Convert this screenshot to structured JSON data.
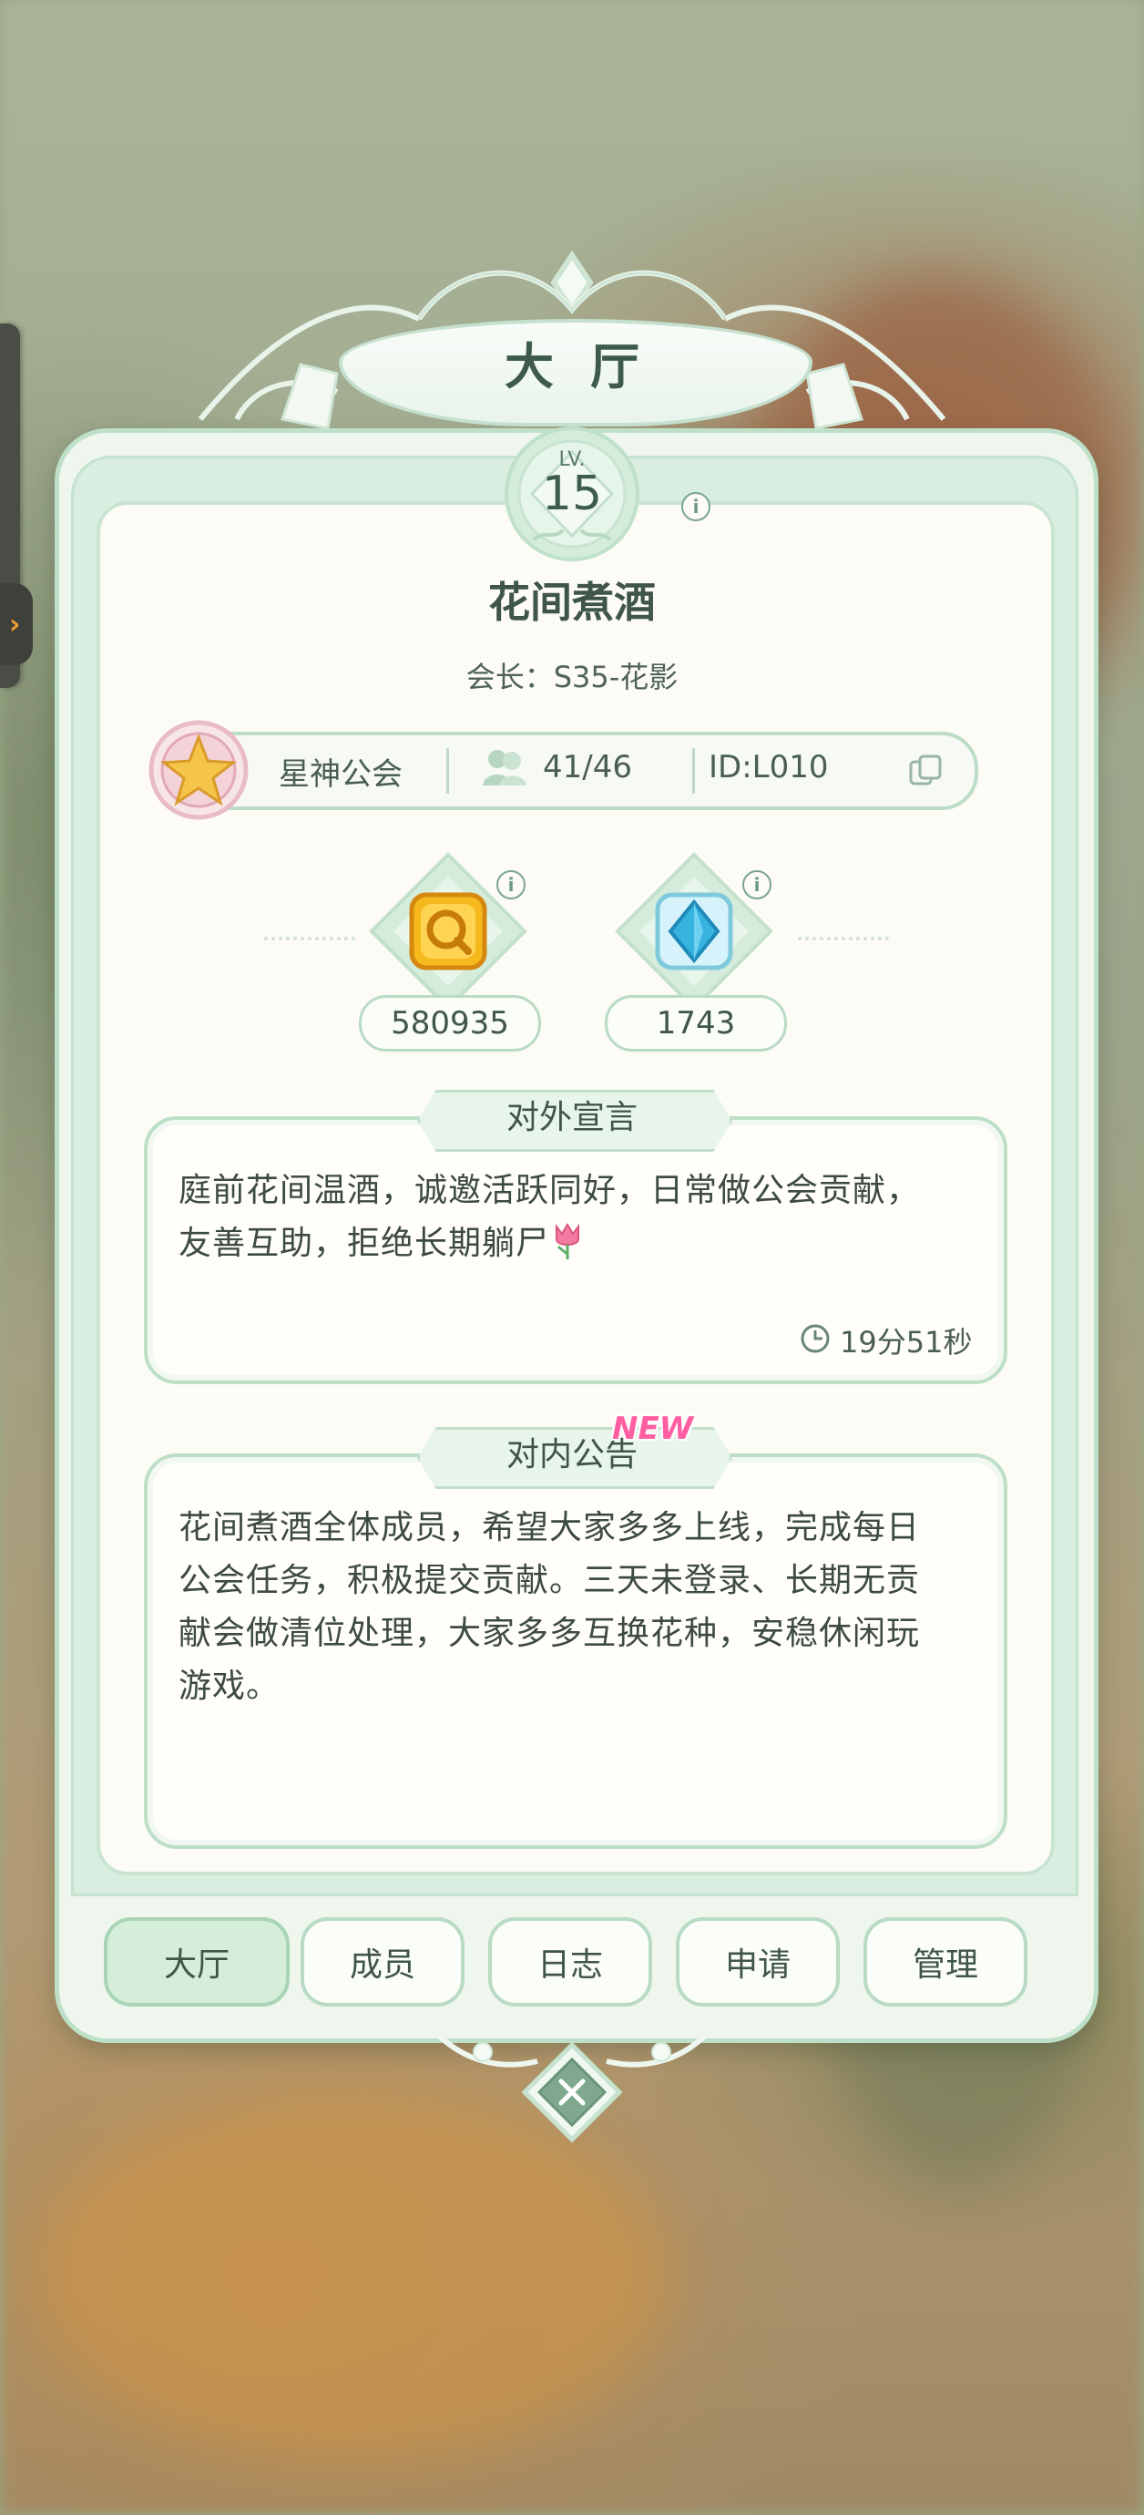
{
  "banner": {
    "title": "大厅"
  },
  "level": {
    "prefix": "LV.",
    "value": "15"
  },
  "guild": {
    "name": "花间煮酒",
    "leader": "会长：S35-花影",
    "tier": "星神公会",
    "members": "41/46",
    "id": "ID:L010"
  },
  "currencies": [
    {
      "name": "gold-coin-icon",
      "value": "580935"
    },
    {
      "name": "blue-gem-icon",
      "value": "1743"
    }
  ],
  "declaration": {
    "title": "对外宣言",
    "text_line1": "庭前花间温酒，诚邀活跃同好，日常做公会贡献，",
    "text_line2": "友善互助，拒绝长期躺尸",
    "timer": "19分51秒"
  },
  "announcement": {
    "title": "对内公告",
    "badge": "NEW",
    "lines": [
      "花间煮酒全体成员，希望大家多多上线，完成每日",
      "公会任务，积极提交贡献。三天未登录、长期无贡",
      "献会做清位处理，大家多多互换花种，安稳休闲玩",
      "游戏。"
    ]
  },
  "tabs": [
    {
      "label": "大厅"
    },
    {
      "label": "成员"
    },
    {
      "label": "日志"
    },
    {
      "label": "申请"
    },
    {
      "label": "管理"
    }
  ],
  "colors": {
    "accent": "#bddfc8",
    "text": "#3f5548",
    "new_badge": "#ff5ea0"
  }
}
